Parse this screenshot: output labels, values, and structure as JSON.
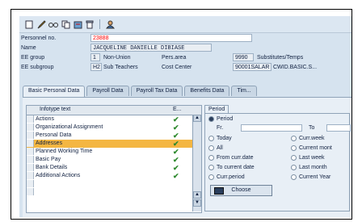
{
  "toolbar": {
    "icons": [
      "new-doc-icon",
      "edit-icon",
      "display-glasses-icon",
      "copy-icon",
      "overview-icon",
      "delete-icon",
      "user-icon"
    ]
  },
  "header": {
    "personnel_no": {
      "label": "Personnel no.",
      "value": "23888"
    },
    "name": {
      "label": "Name",
      "value": "JACQUELINE DANIELLE DIBIASE"
    },
    "ee_group": {
      "label": "EE group",
      "code": "1",
      "text": "Non-Union",
      "pers_area_label": "Pers.area",
      "pers_area_code": "9990",
      "pers_area_text": "Substitutes/Temps"
    },
    "ee_subgroup": {
      "label": "EE subgroup",
      "code": "H2",
      "text": "Sub Teachers",
      "cost_center_label": "Cost Center",
      "cost_center_code": "90001SALAR",
      "cost_center_text": "CWID.BASIC.S..."
    }
  },
  "tabs": [
    "Basic Personal Data",
    "Payroll Data",
    "Payroll Tax Data",
    "Benefits Data",
    "Tim..."
  ],
  "infotypes": {
    "header": "Infotype text",
    "col_e": "E...",
    "items": [
      {
        "label": "Actions",
        "check": true
      },
      {
        "label": "Organizational Assignment",
        "check": true
      },
      {
        "label": "Personal Data",
        "check": true
      },
      {
        "label": "Addresses",
        "check": true
      },
      {
        "label": "Planned Working Time",
        "check": true
      },
      {
        "label": "Basic Pay",
        "check": true
      },
      {
        "label": "Bank Details",
        "check": true
      },
      {
        "label": "Additional Actions",
        "check": true
      }
    ],
    "check_glyph": "✔"
  },
  "period": {
    "title": "Period",
    "period_opt": "Period",
    "from_label": "Fr.",
    "to_label": "To",
    "left_options": [
      "Today",
      "All",
      "From curr.date",
      "To current date",
      "Curr.period"
    ],
    "right_options": [
      "Curr.week",
      "Current mont",
      "Last week",
      "Last month",
      "Current Year"
    ],
    "choose": "Choose"
  },
  "colors": {
    "highlight": "#f4b642",
    "check": "#2f8a2f",
    "accent": "#ff0000"
  }
}
